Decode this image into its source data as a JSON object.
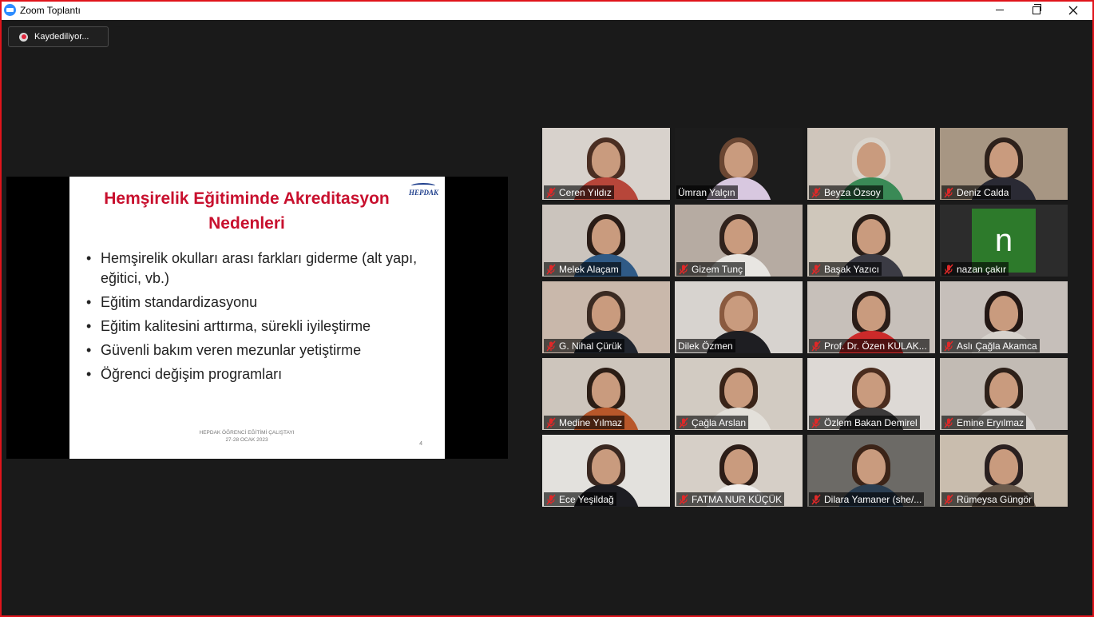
{
  "window": {
    "title": "Zoom Toplantı",
    "controls": {
      "minimize_icon": "minimize-icon",
      "maximize_icon": "restore-icon",
      "close_icon": "close-icon"
    }
  },
  "recording": {
    "label": "Kaydediliyor..."
  },
  "slide": {
    "title_line1": "Hemşirelik Eğitiminde  Akreditasyon",
    "title_line2": "Nedenleri",
    "logo_text": "HEPDAK",
    "bullets": [
      "Hemşirelik okulları arası farkları giderme (alt yapı, eğitici, vb.)",
      "Eğitim standardizasyonu",
      "Eğitim kalitesini arttırma, sürekli iyileştirme",
      "Güvenli bakım veren mezunlar yetiştirme",
      "Öğrenci değişim programları"
    ],
    "footer_line1": "HEPDAK ÖĞRENCİ EĞİTİMİ ÇALIŞTAYI",
    "footer_line2": "27-28 OCAK 2023",
    "page_number": "4"
  },
  "participants": [
    {
      "name": "Ceren Yıldız",
      "muted": true,
      "bg": "#d8d2cc",
      "hair": "#4a2e22",
      "shirt": "#b7463a"
    },
    {
      "name": "Ümran Yalçın",
      "muted": false,
      "bg": "#1c1c1c",
      "hair": "#6a4632",
      "shirt": "#d8c8e0"
    },
    {
      "name": "Beyza Özsoy",
      "muted": true,
      "bg": "#cfc6bc",
      "hair": "#d9d4cc",
      "shirt": "#3a8a56"
    },
    {
      "name": "Deniz Calda",
      "muted": true,
      "bg": "#a79683",
      "hair": "#2e211b",
      "shirt": "#2a2a34"
    },
    {
      "name": "Melek Alaçam",
      "muted": true,
      "bg": "#cbc4bd",
      "hair": "#2a1c16",
      "shirt": "#2f5a86"
    },
    {
      "name": "Gizem Tunç",
      "muted": true,
      "bg": "#b6aba2",
      "hair": "#30221c",
      "shirt": "#e8e6e2"
    },
    {
      "name": "Başak Yazıcı",
      "muted": true,
      "bg": "#cfc7bb",
      "hair": "#2a1e18",
      "shirt": "#3b3b44"
    },
    {
      "name": "nazan çakır",
      "muted": true,
      "avatar_letter": "n",
      "avatar_color": "#2d7a2b"
    },
    {
      "name": "G. Nihal Çürük",
      "muted": true,
      "bg": "#c9b8ab",
      "hair": "#3a2a22",
      "shirt": "#20252e"
    },
    {
      "name": "Dilek Özmen",
      "muted": false,
      "speaking": true,
      "bg": "#d7d3cf",
      "hair": "#8a5a3f",
      "shirt": "#1e1e22"
    },
    {
      "name": "Prof. Dr. Özen KULAK...",
      "muted": true,
      "bg": "#c7c0ba",
      "hair": "#2b1d18",
      "shirt": "#cc2a2a"
    },
    {
      "name": "Aslı Çağla Akamca",
      "muted": true,
      "bg": "#c6bfba",
      "hair": "#231714",
      "shirt": "#d6d2cc"
    },
    {
      "name": "Medine Yılmaz",
      "muted": true,
      "bg": "#cdc5bc",
      "hair": "#2b1d15",
      "shirt": "#b8572a"
    },
    {
      "name": "Çağla Arslan",
      "muted": true,
      "bg": "#d2cbc2",
      "hair": "#3a2418",
      "shirt": "#e3e0da"
    },
    {
      "name": "Özlem Bakan Demirel",
      "muted": true,
      "bg": "#ddd9d5",
      "hair": "#4a2c1e",
      "shirt": "#3c3a3a"
    },
    {
      "name": "Emine Eryılmaz",
      "muted": true,
      "bg": "#c2bbb4",
      "hair": "#2d2019",
      "shirt": "#d8d4d0"
    },
    {
      "name": "Ece Yeşildağ",
      "muted": true,
      "bg": "#e3e1dd",
      "hair": "#3a2820",
      "shirt": "#1d1d22"
    },
    {
      "name": "FATMA NUR KÜÇÜK",
      "muted": true,
      "bg": "#d6cfc7",
      "hair": "#2c1d17",
      "shirt": "#f2f0ee"
    },
    {
      "name": "Dilara Yamaner (she/...",
      "muted": true,
      "bg": "#6c6a66",
      "hair": "#3c2418",
      "shirt": "#2a3e52"
    },
    {
      "name": "Rümeysa Güngör",
      "muted": true,
      "bg": "#c9bdae",
      "hair": "#2a2020",
      "shirt": "#6a5a4c"
    }
  ]
}
